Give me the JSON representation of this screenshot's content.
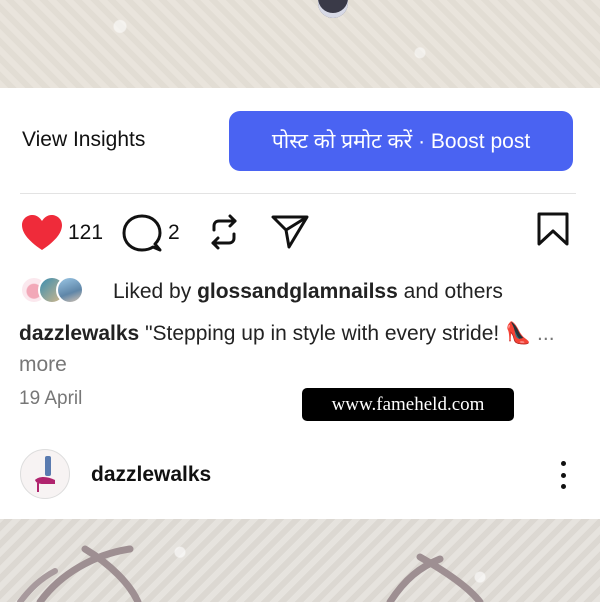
{
  "post_actions": {
    "view_insights_label": "View Insights",
    "boost_label": "पोस्ट को प्रमोट करें · Boost post"
  },
  "engagement": {
    "like_count": "121",
    "comment_count": "2",
    "icons": [
      "heart-filled-icon",
      "comment-icon",
      "repost-icon",
      "share-icon",
      "bookmark-icon"
    ],
    "like_color": "#ef2b3a"
  },
  "likes": {
    "prefix": "Liked by",
    "username": "glossandglamnailss",
    "suffix": "and others"
  },
  "caption": {
    "username": "dazzlewalks",
    "text": "\"Stepping up in style with every stride! 👠",
    "more_label": "... more"
  },
  "date": "19 April",
  "watermark": "www.fameheld.com",
  "next_post": {
    "username": "dazzlewalks"
  },
  "colors": {
    "boost_button": "#4a63f2",
    "muted_text": "#777777"
  }
}
